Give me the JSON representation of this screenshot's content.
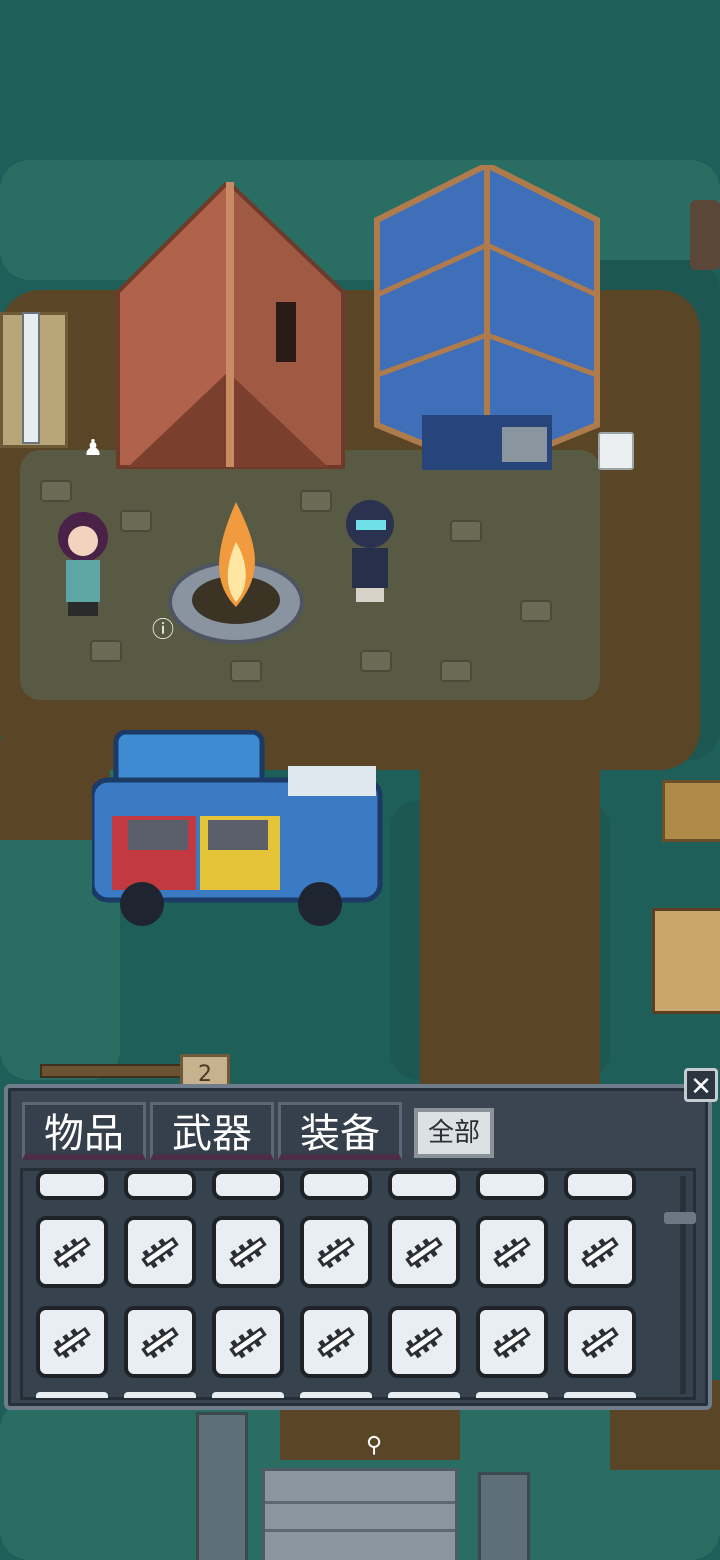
{
  "inventory": {
    "tabs": [
      {
        "label": "物品"
      },
      {
        "label": "武器"
      },
      {
        "label": "装备"
      }
    ],
    "filter_all_label": "全部",
    "close_icon": "close-icon",
    "item_icon": "bullet-clip-icon",
    "rows_visible": 2,
    "columns": 7
  },
  "map": {
    "sign_number": "2"
  },
  "colors": {
    "panel_bg": "#3b4552",
    "slot_bg": "#e9eef2",
    "tab_underline": "#4b2f48"
  }
}
